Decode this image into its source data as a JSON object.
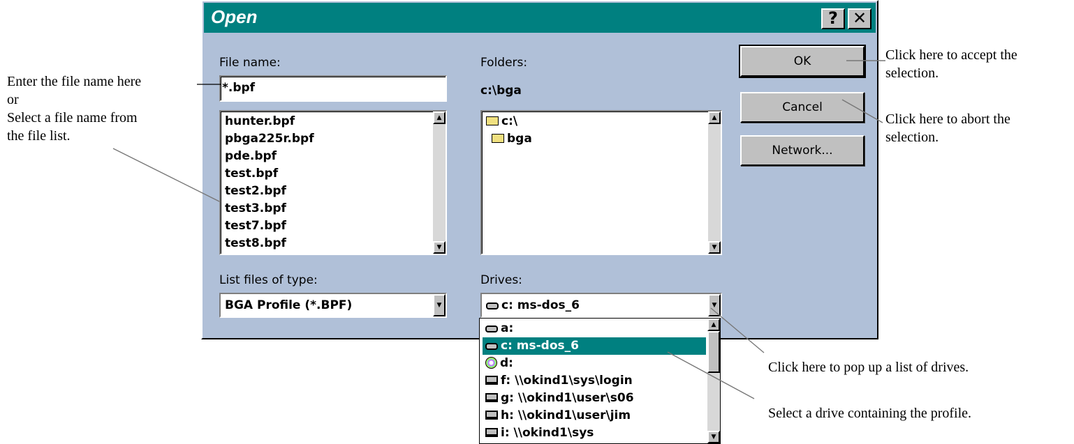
{
  "dialog": {
    "title": "Open",
    "help_button": "?",
    "close_button": "✕",
    "file_name_label": "File name:",
    "file_name_value": "*.bpf",
    "files": [
      "hunter.bpf",
      "pbga225r.bpf",
      "pde.bpf",
      "test.bpf",
      "test2.bpf",
      "test3.bpf",
      "test7.bpf",
      "test8.bpf"
    ],
    "folders_label": "Folders:",
    "current_path": "c:\\bga",
    "folders": [
      "c:\\",
      "bga"
    ],
    "file_type_label": "List files of type:",
    "file_type_value": "BGA Profile (*.BPF)",
    "drives_label": "Drives:",
    "drive_value": "c: ms-dos_6",
    "ok_label": "OK",
    "cancel_label": "Cancel",
    "network_label": "Network..."
  },
  "drives_dropdown": [
    {
      "label": "a:",
      "icon": "floppy-drive-icon"
    },
    {
      "label": "c: ms-dos_6",
      "icon": "hard-drive-icon",
      "selected": true
    },
    {
      "label": "d:",
      "icon": "cd-drive-icon"
    },
    {
      "label": "f: \\\\okind1\\sys\\login",
      "icon": "network-drive-icon"
    },
    {
      "label": "g: \\\\okind1\\user\\s06",
      "icon": "network-drive-icon"
    },
    {
      "label": "h: \\\\okind1\\user\\jim",
      "icon": "network-drive-icon"
    },
    {
      "label": "i: \\\\okind1\\sys",
      "icon": "network-drive-icon"
    }
  ],
  "annotations": {
    "file_name": [
      "Enter the file name here",
      "or",
      "Select a file name from",
      "the file list."
    ],
    "ok": [
      "Click here to accept the",
      "selection."
    ],
    "cancel": [
      "Click here to abort the",
      "selection."
    ],
    "drives_button": "Click here to pop up a list of drives.",
    "drive_select": "Select a drive containing  the profile."
  },
  "colors": {
    "title_bar": "#008080",
    "dialog_bg": "#b0c0d8",
    "selection": "#008080"
  }
}
